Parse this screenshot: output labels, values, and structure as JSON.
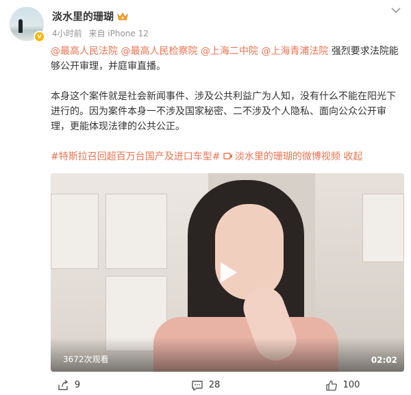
{
  "post": {
    "username": "淡水里的珊瑚",
    "time": "4小时前",
    "source": "来自 iPhone 12",
    "mentions": [
      "@最高人民法院",
      "@最高人民检察院",
      "@上海二中院",
      "@上海青浦法院"
    ],
    "mention_suffix": "强烈要求法院能够公开审理，并庭审直播。",
    "paragraph2": "本身这个案件就是社会新闻事件、涉及公共利益广为人知，没有什么不能在阳光下进行的。因为案件本身一不涉及国家秘密、二不涉及个人隐私、面向公众公开审理，更能体现法律的公共公正。",
    "topic": "#特斯拉召回超百万台国产及进口车型#",
    "video_link": "淡水里的珊瑚的微博视频",
    "collapse": "收起"
  },
  "video": {
    "views": "3672次观看",
    "duration": "02:02"
  },
  "actions": {
    "share_count": "9",
    "comment_count": "28",
    "like_count": "100"
  },
  "colors": {
    "accent": "#eb7350",
    "verified": "#f7b500",
    "meta": "#939393"
  }
}
